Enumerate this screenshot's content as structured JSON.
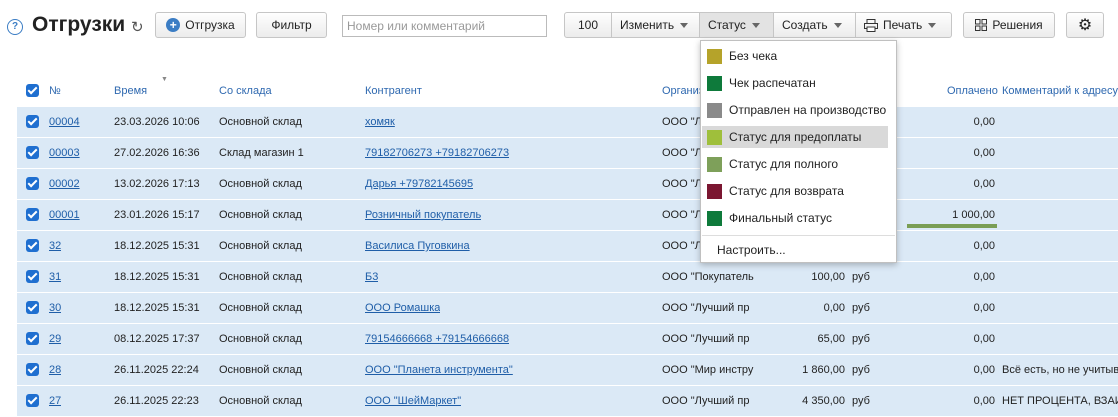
{
  "header": {
    "title": "Отгрузки",
    "add_label": "Отгрузка",
    "filter_label": "Фильтр",
    "search_placeholder": "Номер или комментарий",
    "page_size": "100",
    "change_label": "Изменить",
    "status_label": "Статус",
    "create_label": "Создать",
    "print_label": "Печать",
    "solutions_label": "Решения"
  },
  "columns": [
    "№",
    "Время",
    "Со склада",
    "Контрагент",
    "Организ",
    "Оплачено",
    "Комментарий к адресу"
  ],
  "rows": [
    {
      "num": "00004",
      "time": "23.03.2026 10:06",
      "warehouse": "Основной склад",
      "contractor": "хомяк",
      "org": "ООО \"Л",
      "sum": "",
      "cur": "",
      "paid": "0,00",
      "comment": ""
    },
    {
      "num": "00003",
      "time": "27.02.2026 16:36",
      "warehouse": "Склад магазин 1",
      "contractor": "79182706273 +79182706273",
      "org": "ООО \"Л",
      "sum": "",
      "cur": "",
      "paid": "0,00",
      "comment": ""
    },
    {
      "num": "00002",
      "time": "13.02.2026 17:13",
      "warehouse": "Основной склад",
      "contractor": "Дарья +79782145695",
      "org": "ООО \"Л",
      "sum": "",
      "cur": "",
      "paid": "0,00",
      "comment": ""
    },
    {
      "num": "00001",
      "time": "23.01.2026 15:17",
      "warehouse": "Основной склад",
      "contractor": "Розничный покупатель",
      "org": "ООО \"Л",
      "sum": "",
      "cur": "",
      "paid": "1 000,00",
      "comment": ""
    },
    {
      "num": "32",
      "time": "18.12.2025 15:31",
      "warehouse": "Основной склад",
      "contractor": "Василиса Пуговкина",
      "org": "ООО \"Л",
      "sum": "",
      "cur": "",
      "paid": "0,00",
      "comment": ""
    },
    {
      "num": "31",
      "time": "18.12.2025 15:31",
      "warehouse": "Основной склад",
      "contractor": "Б3",
      "org": "ООО \"Покупатель",
      "sum": "100,00",
      "cur": "руб",
      "paid": "0,00",
      "comment": ""
    },
    {
      "num": "30",
      "time": "18.12.2025 15:31",
      "warehouse": "Основной склад",
      "contractor": "ООО Ромашка",
      "org": "ООО \"Лучший пр",
      "sum": "0,00",
      "cur": "руб",
      "paid": "0,00",
      "comment": ""
    },
    {
      "num": "29",
      "time": "08.12.2025 17:37",
      "warehouse": "Основной склад",
      "contractor": "79154666668 +79154666668",
      "org": "ООО \"Лучший пр",
      "sum": "65,00",
      "cur": "руб",
      "paid": "0,00",
      "comment": ""
    },
    {
      "num": "28",
      "time": "26.11.2025 22:24",
      "warehouse": "Основной склад",
      "contractor": "ООО \"Планета инструмента\"",
      "org": "ООО \"Мир инстру",
      "sum": "1 860,00",
      "cur": "руб",
      "paid": "0,00",
      "comment": "Всё есть, но не учитыв"
    },
    {
      "num": "27",
      "time": "26.11.2025 22:23",
      "warehouse": "Основной склад",
      "contractor": "ООО \"ШейМаркет\"",
      "org": "ООО \"Лучший пр",
      "sum": "4 350,00",
      "cur": "руб",
      "paid": "0,00",
      "comment": "НЕТ ПРОЦЕНТА, ВЗАИМ"
    }
  ],
  "status_menu": {
    "items": [
      {
        "label": "Без чека",
        "color": "#b5a32a"
      },
      {
        "label": "Чек распечатан",
        "color": "#0e7a3b"
      },
      {
        "label": "Отправлен на производство",
        "color": "#8a8a8a"
      },
      {
        "label": "Статус для предоплаты",
        "color": "#9fbf3b"
      },
      {
        "label": "Статус для полного",
        "color": "#7ea05a"
      },
      {
        "label": "Статус для возврата",
        "color": "#7b1631"
      },
      {
        "label": "Финальный статус",
        "color": "#0e7a3b"
      }
    ],
    "configure_label": "Настроить..."
  },
  "colors": {
    "accent": "#1f6fd0",
    "row_bg": "#dbe9f6",
    "link": "#1f5ea8"
  },
  "icons": [
    "help-icon",
    "refresh-icon",
    "plus-icon",
    "print-icon",
    "solutions-icon",
    "gear-icon",
    "sort-icon"
  ]
}
